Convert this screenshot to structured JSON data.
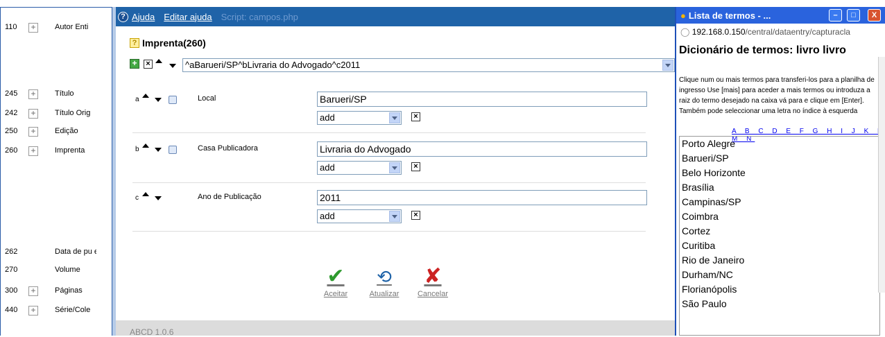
{
  "left_fields": [
    {
      "tag": "110",
      "plus": true,
      "label": "Autor Enti"
    },
    {
      "tag": "245",
      "plus": true,
      "label": "Título"
    },
    {
      "tag": "242",
      "plus": true,
      "label": "Título Orig"
    },
    {
      "tag": "250",
      "plus": true,
      "label": "Edição"
    },
    {
      "tag": "260",
      "plus": true,
      "label": "Imprenta"
    },
    {
      "tag": "262",
      "plus": false,
      "label": "Data de pu extenso"
    },
    {
      "tag": "270",
      "plus": false,
      "label": "Volume"
    },
    {
      "tag": "300",
      "plus": true,
      "label": "Páginas"
    },
    {
      "tag": "440",
      "plus": true,
      "label": "Série/Cole"
    }
  ],
  "toolbar": {
    "help": "Ajuda",
    "edit_help": "Editar ajuda",
    "script": "Script: campos.php"
  },
  "field": {
    "title": "Imprenta(260)",
    "value": "^aBarueri/SP^bLivraria do Advogado^c2011"
  },
  "subfields": [
    {
      "code": "a",
      "name": "Local",
      "value": "Barueri/SP",
      "add": "add",
      "lookup": true
    },
    {
      "code": "b",
      "name": "Casa Publicadora",
      "value": "Livraria do Advogado",
      "add": "add",
      "lookup": true
    },
    {
      "code": "c",
      "name": "Ano de Publicação",
      "value": "2011",
      "add": "add",
      "lookup": false
    }
  ],
  "buttons": {
    "accept": "Aceitar",
    "update": "Atualizar",
    "cancel": "Cancelar"
  },
  "footer": "ABCD 1.0.6",
  "term_window": {
    "title": "Lista de termos - ...",
    "url_host": "192.168.0.150",
    "url_path": "/central/dataentry/capturacla",
    "heading": "Dicionário de termos: livro livro",
    "info": "Clique num ou mais termos para transferi-los para a planilha de ingresso Use [mais] para aceder a mais termos ou introduza a raiz do termo desejado na caixa vá para e clique em [Enter]. Também pode seleccionar uma letra no índice à esquerda",
    "letters": "A B C D E F G H I J K L M N",
    "terms": [
      "Porto Alegre",
      "Barueri/SP",
      "Belo Horizonte",
      "Brasília",
      "Campinas/SP",
      "Coimbra",
      "Cortez",
      "Curitiba",
      "Rio de Janeiro",
      "Durham/NC",
      "Florianópolis",
      "São Paulo"
    ]
  },
  "colors": {
    "titlebar": "#2a63dd",
    "dialog_top": "#1f63a8",
    "accept": "#2e9a2e",
    "cancel": "#cc2222"
  }
}
